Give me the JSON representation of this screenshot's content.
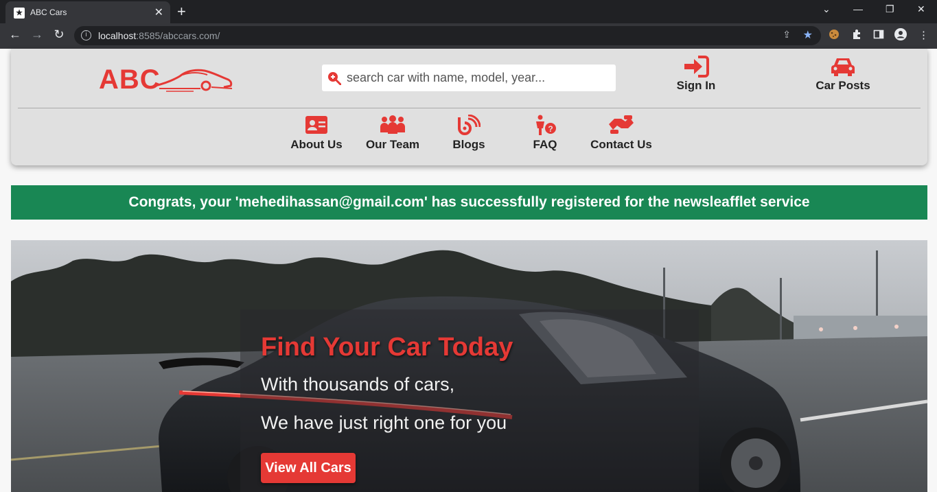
{
  "browser": {
    "tab_title": "ABC Cars",
    "url_host": "localhost",
    "url_rest": ":8585/abccars.com/"
  },
  "header": {
    "logo_text": "ABC",
    "search_placeholder": "search car with name, model, year...",
    "signin_label": "Sign In",
    "carposts_label": "Car Posts"
  },
  "nav": {
    "items": [
      {
        "label": "About Us"
      },
      {
        "label": "Our Team"
      },
      {
        "label": "Blogs"
      },
      {
        "label": "FAQ"
      },
      {
        "label": "Contact Us"
      }
    ]
  },
  "alert": {
    "message": "Congrats, your 'mehedihassan@gmail.com' has successfully registered for the newsleafflet service"
  },
  "hero": {
    "title": "Find Your Car Today",
    "line1": "With thousands of cars,",
    "line2": "We have just right one for you",
    "button": "View All Cars"
  },
  "colors": {
    "brand_red": "#e53935",
    "alert_green": "#198754"
  }
}
